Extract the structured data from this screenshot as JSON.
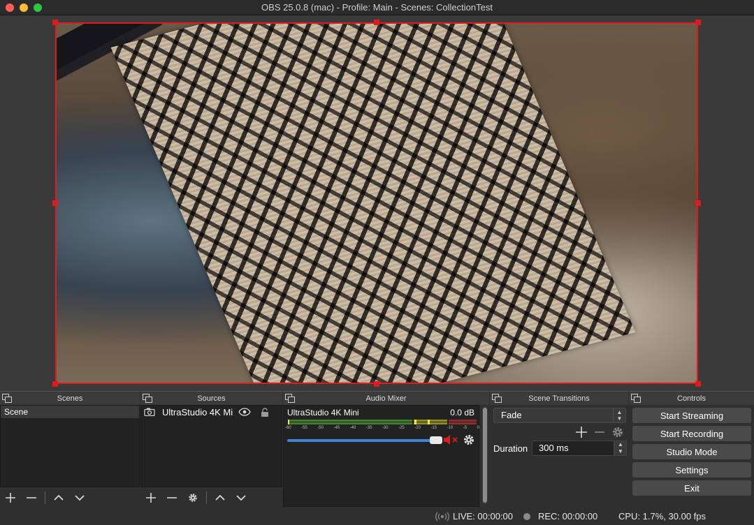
{
  "window": {
    "title": "OBS 25.0.8 (mac) - Profile: Main - Scenes: CollectionTest"
  },
  "colors": {
    "selection": "#e01b1b",
    "meter_green": "#4caf2a",
    "meter_yellow": "#c9c92a",
    "meter_red": "#d03a3a",
    "slider": "#3d84d8"
  },
  "docks": {
    "scenes": {
      "title": "Scenes",
      "items": [
        "Scene"
      ]
    },
    "sources": {
      "title": "Sources",
      "items": [
        {
          "name": "UltraStudio 4K Mi",
          "icon": "camera-icon"
        }
      ]
    },
    "mixer": {
      "title": "Audio Mixer",
      "channel": {
        "name": "UltraStudio 4K Mini",
        "db": "0.0 dB",
        "ticks": [
          "-60",
          "-55",
          "-50",
          "-45",
          "-40",
          "-35",
          "-30",
          "-25",
          "-20",
          "-15",
          "-10",
          "-5",
          "0"
        ],
        "volume": 1.0
      }
    },
    "transitions": {
      "title": "Scene Transitions",
      "selected": "Fade",
      "duration_label": "Duration",
      "duration_value": "300 ms"
    },
    "controls": {
      "title": "Controls",
      "buttons": [
        "Start Streaming",
        "Start Recording",
        "Studio Mode",
        "Settings",
        "Exit"
      ]
    }
  },
  "status": {
    "live": "LIVE: 00:00:00",
    "rec": "REC: 00:00:00",
    "cpu": "CPU: 1.7%, 30.00 fps"
  }
}
